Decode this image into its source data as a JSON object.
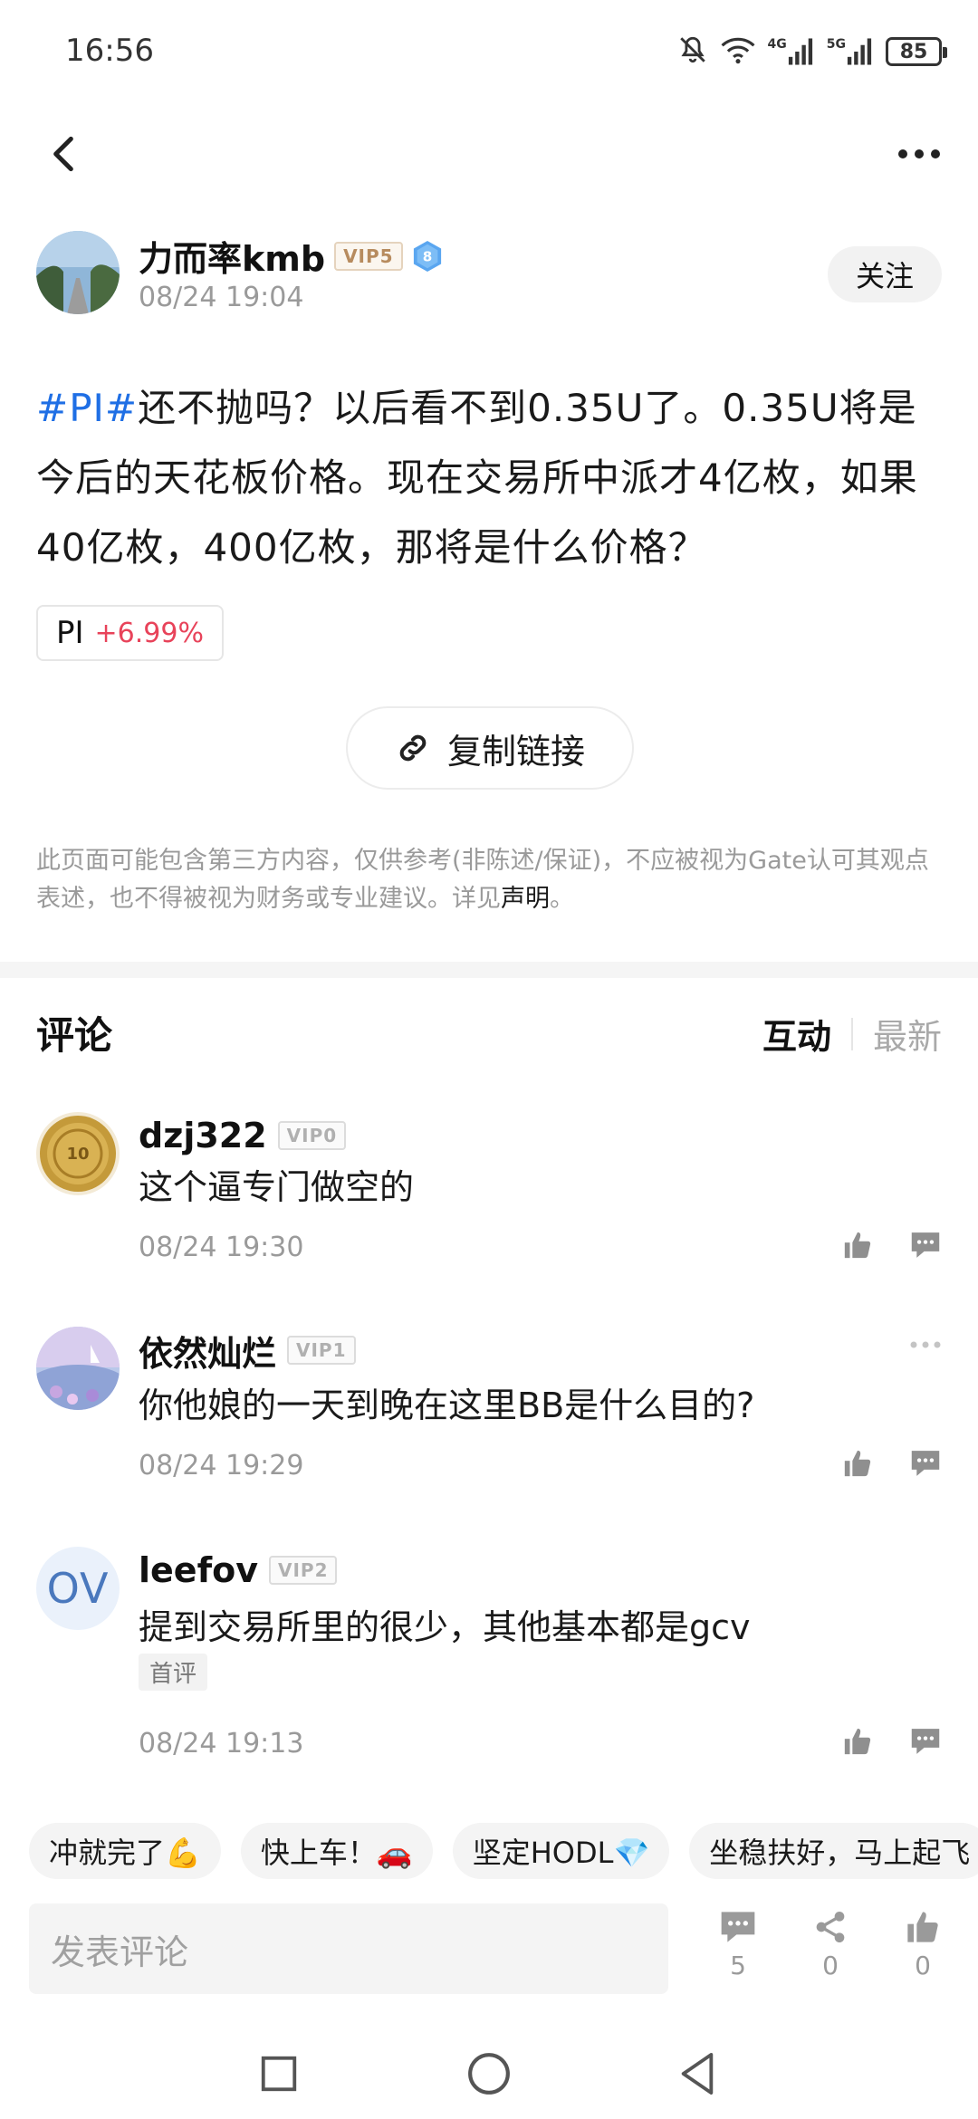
{
  "status_bar": {
    "time": "16:56",
    "battery": "85",
    "network_1": "4G",
    "network_2": "5G"
  },
  "post": {
    "author_name": "力而率kmb",
    "author_vip": "VIP5",
    "author_level": "8",
    "time": "08/24 19:04",
    "follow_label": "关注",
    "hashtag": "#PI#",
    "body": "还不抛吗？以后看不到0.35U了。0.35U将是今后的天花板价格。现在交易所中派才4亿枚，如果40亿枚，400亿枚，那将是什么价格？",
    "coin_symbol": "PI",
    "coin_change": "+6.99%",
    "copy_link_label": "复制链接",
    "disclaimer": "此页面可能包含第三方内容，仅供参考(非陈述/保证)，不应被视为Gate认可其观点表述，也不得被视为财务或专业建议。详见",
    "disclaimer_link": "声明",
    "disclaimer_end": "。"
  },
  "comments_section": {
    "title": "评论",
    "sort_active": "互动",
    "sort_inactive": "最新",
    "items": [
      {
        "name": "dzj322",
        "vip": "VIP0",
        "text": "这个逼专门做空的",
        "time": "08/24 19:30"
      },
      {
        "name": "依然灿烂",
        "vip": "VIP1",
        "text": "你他娘的一天到晚在这里BB是什么目的?",
        "time": "08/24 19:29"
      },
      {
        "name": "leefov",
        "vip": "VIP2",
        "avatar_text": "OV",
        "text": "提到交易所里的很少，其他基本都是gcv",
        "tag": "首评",
        "time": "08/24 19:13"
      }
    ]
  },
  "quick_replies": [
    "冲就完了💪",
    "快上车！🚗",
    "坚定HODL💎",
    "坐稳扶好，马上起飞"
  ],
  "bottom_bar": {
    "input_placeholder": "发表评论",
    "comments_count": "5",
    "shares_count": "0",
    "likes_count": "0"
  },
  "colors": {
    "hashtag": "#1f6fe5",
    "price_up": "#e8435a",
    "vip5": "#b78b5e",
    "level_badge": "#5aa6f0"
  }
}
